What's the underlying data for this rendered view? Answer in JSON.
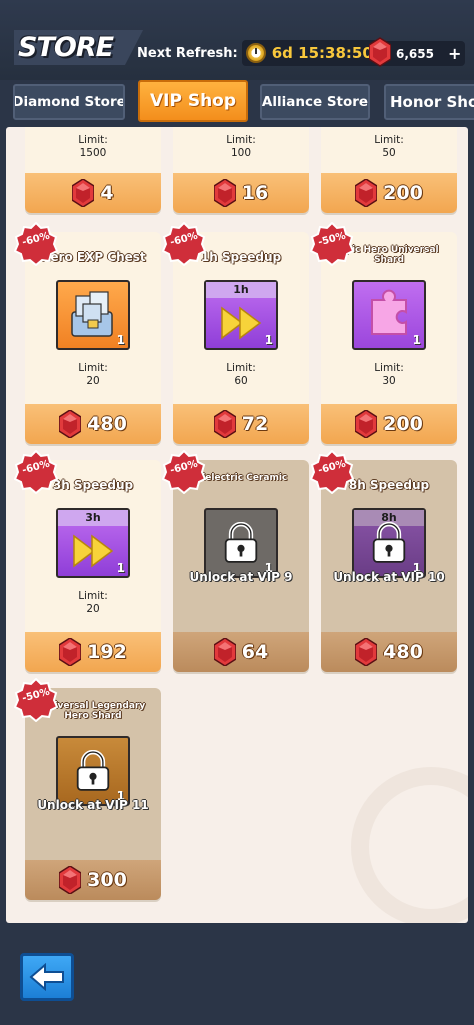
{
  "header": {
    "title": "STORE",
    "refresh_label": "Next Refresh:",
    "refresh_time": "6d 15:38:50",
    "gem_balance": "6,655",
    "plus_label": "+"
  },
  "tabs": [
    {
      "label": "Diamond Store",
      "active": false
    },
    {
      "label": "VIP Shop",
      "active": true
    },
    {
      "label": "Alliance Store",
      "active": false
    },
    {
      "label": "Honor Sho",
      "active": false
    }
  ],
  "items": [
    {
      "title": "",
      "limit_label": "Limit:",
      "limit": "1500",
      "price": "4"
    },
    {
      "title": "",
      "limit_label": "Limit:",
      "limit": "100",
      "price": "16"
    },
    {
      "title": "",
      "limit_label": "Limit:",
      "limit": "50",
      "price": "200"
    },
    {
      "title": "Hero EXP Chest",
      "discount": "-60%",
      "qty": "1",
      "limit_label": "Limit:",
      "limit": "20",
      "price": "480",
      "icon": "hero-exp-chest-icon"
    },
    {
      "title": "1h Speedup",
      "discount": "-60%",
      "banner": "1h",
      "qty": "1",
      "limit_label": "Limit:",
      "limit": "60",
      "price": "72",
      "icon": "speedup-icon"
    },
    {
      "title": "Epic Hero Universal Shard",
      "discount": "-50%",
      "qty": "1",
      "limit_label": "Limit:",
      "limit": "30",
      "price": "200",
      "icon": "puzzle-shard-icon"
    },
    {
      "title": "3h Speedup",
      "discount": "-60%",
      "banner": "3h",
      "qty": "1",
      "limit_label": "Limit:",
      "limit": "20",
      "price": "192",
      "icon": "speedup-icon"
    },
    {
      "title": "Dielectric Ceramic",
      "discount": "-60%",
      "qty": "1",
      "unlock": "Unlock at VIP 9",
      "price": "64",
      "icon": "lock-icon"
    },
    {
      "title": "8h Speedup",
      "discount": "-60%",
      "banner": "8h",
      "qty": "1",
      "unlock": "Unlock at VIP 10",
      "price": "480",
      "icon": "lock-icon"
    },
    {
      "title": "Universal Legendary Hero Shard",
      "discount": "-50%",
      "qty": "1",
      "unlock": "Unlock at VIP 11",
      "price": "300",
      "icon": "lock-icon"
    }
  ],
  "colors": {
    "background": "#2b3547",
    "accent": "#f38e1c",
    "gem": "#d9343b",
    "panel": "#f7efe9"
  }
}
